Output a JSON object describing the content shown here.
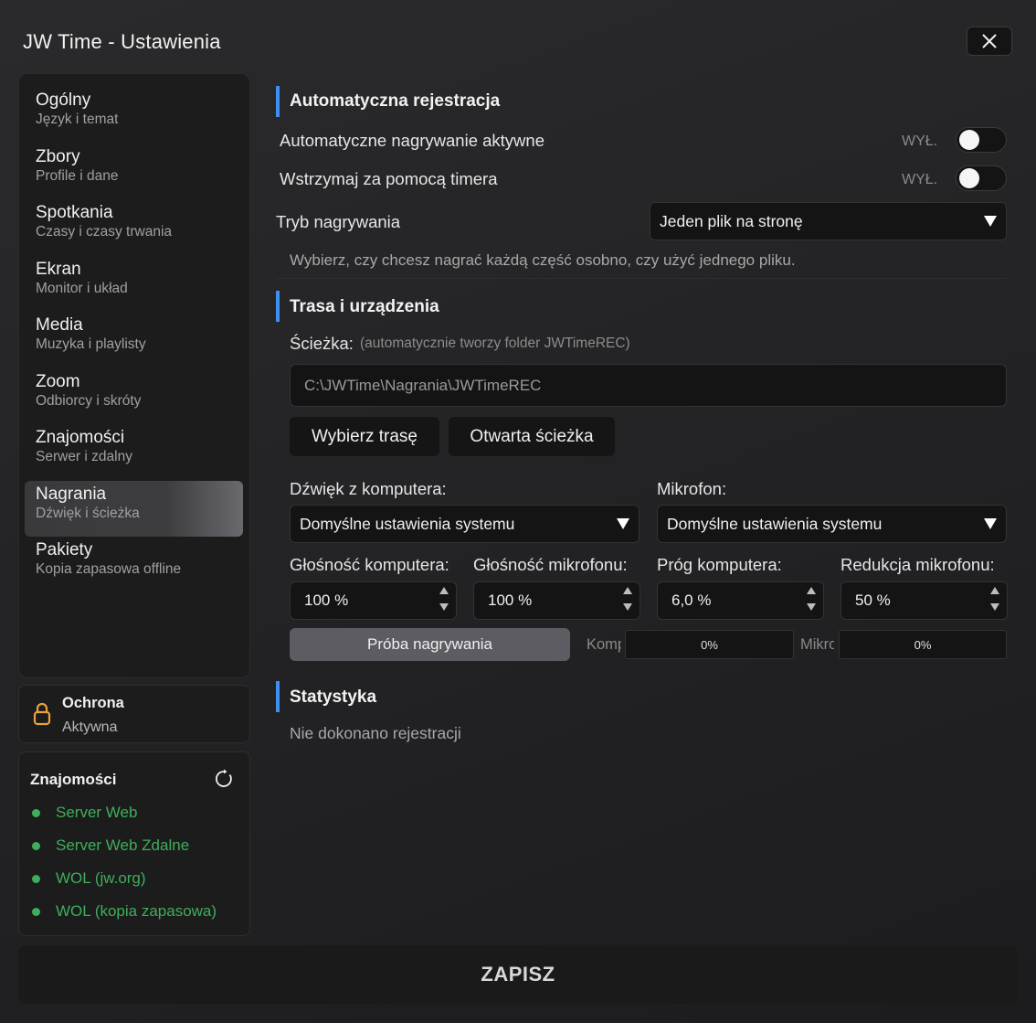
{
  "window": {
    "title": "JW Time - Ustawienia"
  },
  "sidebar": {
    "items": [
      {
        "label": "Ogólny",
        "sub": "Język i temat"
      },
      {
        "label": "Zbory",
        "sub": "Profile i dane"
      },
      {
        "label": "Spotkania",
        "sub": "Czasy i czasy trwania"
      },
      {
        "label": "Ekran",
        "sub": "Monitor i układ"
      },
      {
        "label": "Media",
        "sub": "Muzyka i playlisty"
      },
      {
        "label": "Zoom",
        "sub": "Odbiorcy i skróty"
      },
      {
        "label": "Znajomości",
        "sub": "Serwer i zdalny"
      },
      {
        "label": "Nagrania",
        "sub": "Dźwięk i ścieżka"
      },
      {
        "label": "Pakiety",
        "sub": "Kopia zapasowa offline"
      }
    ],
    "active_index": 7
  },
  "protection": {
    "title": "Ochrona",
    "status": "Aktywna",
    "icon": "lock-icon"
  },
  "connections": {
    "title": "Znajomości",
    "items": [
      "Server Web",
      "Server Web Zdalne",
      "WOL (jw.org)",
      "WOL (kopia zapasowa)"
    ],
    "status_color": "#3fae5a"
  },
  "auto": {
    "title": "Automatyczna rejestracja",
    "row1_label": "Automatyczne nagrywanie aktywne",
    "row1_state": "WYŁ.",
    "row2_label": "Wstrzymaj za pomocą timera",
    "row2_state": "WYŁ.",
    "mode_label": "Tryb nagrywania",
    "mode_value": "Jeden plik na stronę",
    "mode_hint": "Wybierz, czy chcesz nagrać każdą część osobno, czy użyć jednego pliku."
  },
  "route": {
    "title": "Trasa i urządzenia",
    "path_label": "Ścieżka:",
    "path_note": "(automatycznie tworzy folder JWTimeREC)",
    "path_value": "C:\\JWTime\\Nagrania\\JWTimeREC",
    "choose_button": "Wybierz trasę",
    "open_button": "Otwarta ścieżka",
    "pc_audio_label": "Dźwięk z komputera:",
    "pc_audio_value": "Domyślne ustawienia systemu",
    "mic_label": "Mikrofon:",
    "mic_value": "Domyślne ustawienia systemu",
    "vol_pc_label": "Głośność komputera:",
    "vol_pc_value": "100 %",
    "vol_mic_label": "Głośność mikrofonu:",
    "vol_mic_value": "100 %",
    "threshold_label": "Próg komputera:",
    "threshold_value": "6,0 %",
    "reduction_label": "Redukcja mikrofonu:",
    "reduction_value": "50 %",
    "test_button": "Próba nagrywania",
    "meter_pc_label": "Komp",
    "meter_pc_value": "0%",
    "meter_mic_label": "Mikro",
    "meter_mic_value": "0%"
  },
  "stats": {
    "title": "Statystyka",
    "text": "Nie dokonano rejestracji"
  },
  "footer": {
    "save_label": "ZAPISZ"
  },
  "colors": {
    "accent": "#3d8ff0",
    "lock": "#e8a33a"
  }
}
